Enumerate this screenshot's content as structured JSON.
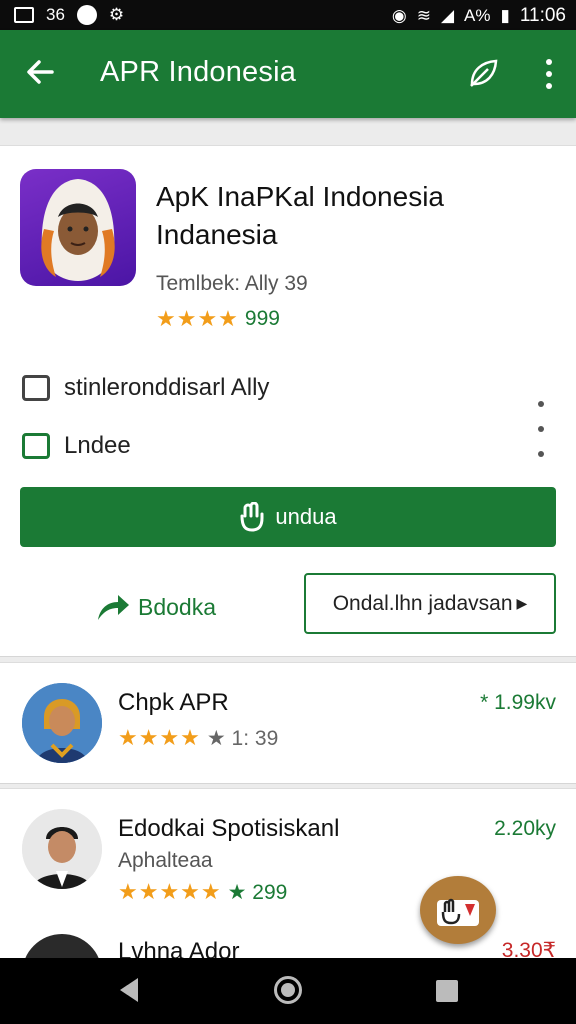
{
  "status_bar": {
    "left_text": "36",
    "battery": "A%",
    "time": "11:06"
  },
  "app_bar": {
    "title": "APR Indonesia"
  },
  "app": {
    "name": "ApK InaPKal Indonesia Indanesia",
    "developer": "Temlbek:  Ally 39",
    "stars": "★★★★",
    "rating_count": "999"
  },
  "info": {
    "row1": "stinleronddisarl Ally",
    "row2": "Lndee"
  },
  "actions": {
    "install_label": "undua",
    "share_label": "Bdodka",
    "secondary_label": "Ondal.lhn jadavsan"
  },
  "list": [
    {
      "title": "Chpk APR",
      "sub": "",
      "stars": "★★★★",
      "rating": "★ 1: 39",
      "price": "* 1.99kv"
    },
    {
      "title": "Edodkai Spotisiskanl",
      "sub": "Aphalteaa",
      "stars": "★★★★★",
      "rating": "★ 299",
      "price": "2.20ky"
    },
    {
      "title": "Lvhna Ador",
      "price": "3.30₹"
    }
  ],
  "colors": {
    "primary": "#1b7a35",
    "star": "#f29d1a"
  }
}
